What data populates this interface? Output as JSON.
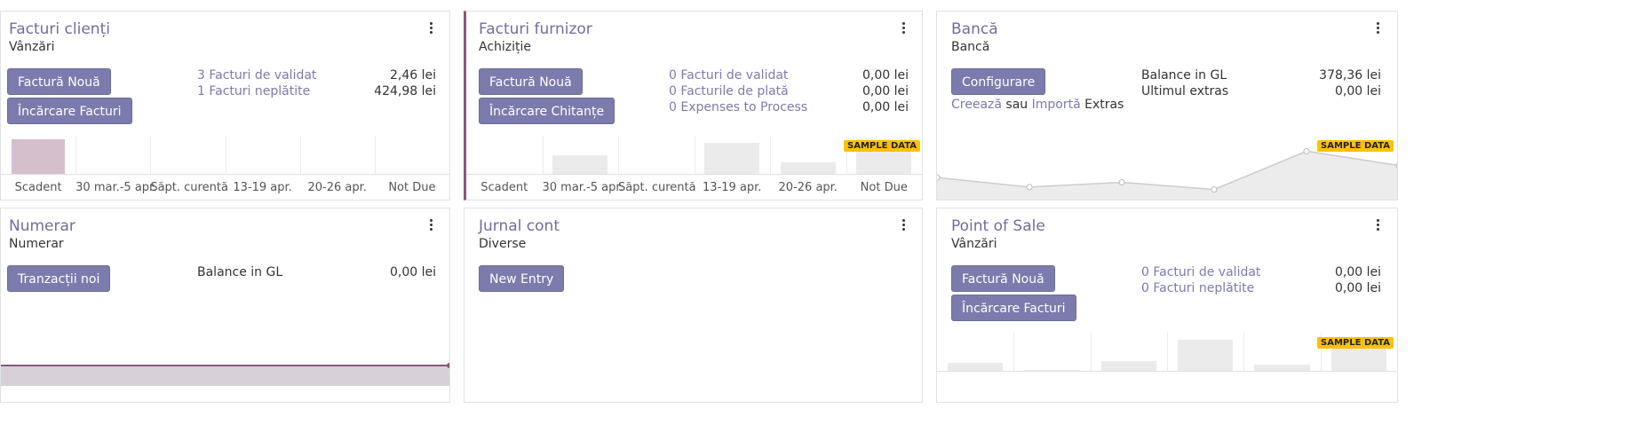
{
  "cards": {
    "facturi_clienti": {
      "title": "Facturi clienți",
      "subtitle": "Vânzări",
      "btn_new": "Factură Nouă",
      "btn_upload": "Încărcare Facturi",
      "rows": [
        {
          "label": "3 Facturi de validat",
          "amount": "2,46 lei"
        },
        {
          "label": "1 Facturi neplătite",
          "amount": "424,98 lei"
        }
      ],
      "chart_labels": [
        "Scadent",
        "30 mar.-5 apr.",
        "Săpt. curentă",
        "13-19 apr.",
        "20-26 apr.",
        "Not Due"
      ]
    },
    "facturi_furnizor": {
      "title": "Facturi furnizor",
      "subtitle": "Achiziție",
      "btn_new": "Factură Nouă",
      "btn_upload": "Încărcare Chitanțe",
      "rows": [
        {
          "label": "0 Facturi de validat",
          "amount": "0,00 lei"
        },
        {
          "label": "0 Facturile de plată",
          "amount": "0,00 lei"
        },
        {
          "label": "0 Expenses to Process",
          "amount": "0,00 lei"
        }
      ],
      "badge": "SAMPLE DATA",
      "chart_labels": [
        "Scadent",
        "30 mar.-5 apr.",
        "Săpt. curentă",
        "13-19 apr.",
        "20-26 apr.",
        "Not Due"
      ]
    },
    "banca": {
      "title": "Bancă",
      "subtitle": "Bancă",
      "btn_config": "Configurare",
      "rows": [
        {
          "label": "Balance in GL",
          "amount": "378,36 lei"
        },
        {
          "label": "Ultimul extras",
          "amount": "0,00 lei"
        }
      ],
      "create_link": "Creează",
      "sau": "sau",
      "import_link": "Importă",
      "extras": "Extras",
      "badge": "SAMPLE DATA"
    },
    "numerar": {
      "title": "Numerar",
      "subtitle": "Numerar",
      "btn_new": "Tranzacții noi",
      "rows": [
        {
          "label": "Balance in GL",
          "amount": "0,00 lei"
        }
      ]
    },
    "jurnal_cont": {
      "title": "Jurnal cont",
      "subtitle": "Diverse",
      "btn_new": "New Entry"
    },
    "point_of_sale": {
      "title": "Point of Sale",
      "subtitle": "Vânzări",
      "btn_new": "Factură Nouă",
      "btn_upload": "Încărcare Facturi",
      "rows": [
        {
          "label": "0 Facturi de validat",
          "amount": "0,00 lei"
        },
        {
          "label": "0 Facturi neplătite",
          "amount": "0,00 lei"
        }
      ],
      "badge": "SAMPLE DATA"
    }
  },
  "colors": {
    "accent": "#7c7bad",
    "brand": "#875a7b",
    "badge": "#ffc107"
  },
  "chart_data": [
    {
      "type": "bar",
      "card": "Facturi clienți",
      "categories": [
        "Scadent",
        "30 mar.-5 apr.",
        "Săpt. curentă",
        "13-19 apr.",
        "20-26 apr.",
        "Not Due"
      ],
      "values": [
        1,
        0,
        0,
        0,
        0,
        0
      ]
    },
    {
      "type": "bar",
      "card": "Facturi furnizor",
      "categories": [
        "Scadent",
        "30 mar.-5 apr.",
        "Săpt. curentă",
        "13-19 apr.",
        "20-26 apr.",
        "Not Due"
      ],
      "values": [
        0,
        0.55,
        0,
        0.9,
        0.35,
        1
      ]
    },
    {
      "type": "line",
      "card": "Bancă",
      "values": [
        0.35,
        0.15,
        0.25,
        0.1,
        0.9,
        0.6
      ]
    },
    {
      "type": "area",
      "card": "Numerar",
      "values": [
        0,
        0
      ]
    },
    {
      "type": "bar",
      "card": "Point of Sale",
      "values": [
        0.25,
        0.05,
        0.3,
        0.9,
        0.2,
        0.75
      ]
    }
  ]
}
